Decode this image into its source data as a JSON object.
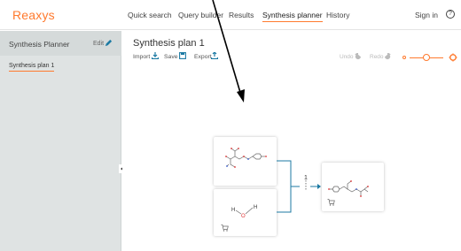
{
  "brand": {
    "name": "Reaxys"
  },
  "nav": {
    "items": [
      {
        "label": "Quick search"
      },
      {
        "label": "Query builder"
      },
      {
        "label": "Results"
      },
      {
        "label": "Synthesis planner",
        "active": true
      },
      {
        "label": "History"
      }
    ],
    "sign_in": "Sign in",
    "help_icon": "question-circle-icon"
  },
  "sidebar": {
    "title": "Synthesis Planner",
    "edit_label": "Edit",
    "items": [
      {
        "label": "Synthesis plan 1",
        "selected": true
      }
    ]
  },
  "plan": {
    "title": "Synthesis plan 1",
    "toolbar": {
      "import_label": "Import",
      "save_label": "Save",
      "export_label": "Export",
      "undo_label": "Undo",
      "redo_label": "Redo"
    },
    "zoom": {
      "level": 0.5
    }
  },
  "diagram": {
    "step_number": "1"
  },
  "colors": {
    "accent": "#ff7a2e",
    "connector": "#1c7aa3",
    "sidebar_bg": "#dfe3e3"
  }
}
